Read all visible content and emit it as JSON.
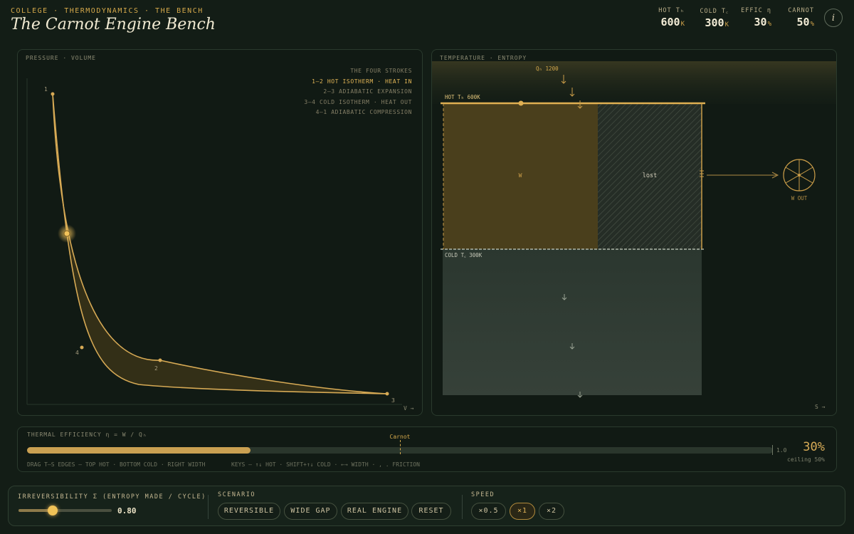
{
  "header": {
    "kicker": "COLLEGE · THERMODYNAMICS · THE BENCH",
    "title": "The Carnot Engine Bench",
    "stats": [
      {
        "label": "HOT Tₕ",
        "value": "600",
        "unit": "K"
      },
      {
        "label": "COLD T꜀",
        "value": "300",
        "unit": "K"
      },
      {
        "label": "EFFIC η",
        "value": "30",
        "unit": "%"
      },
      {
        "label": "CARNOT",
        "value": "50",
        "unit": "%"
      }
    ],
    "info_glyph": "i"
  },
  "pv": {
    "label": "PRESSURE · VOLUME",
    "axis_x": "V →",
    "legend_title": "THE FOUR STROKES",
    "strokes": [
      "1–2  HOT ISOTHERM · HEAT IN",
      "2–3  ADIABATIC EXPANSION",
      "3–4  COLD ISOTHERM · HEAT OUT",
      "4–1  ADIABATIC COMPRESSION"
    ],
    "active_stroke": 0,
    "points": [
      "1",
      "2",
      "3",
      "4"
    ]
  },
  "ts": {
    "label": "TEMPERATURE · ENTROPY",
    "qh_label": "Qₕ 1200",
    "hot_label": "HOT  Tₕ 600K",
    "cold_label": "COLD  T꜀ 300K",
    "work_label": "W",
    "lost_label": "lost",
    "wout_label": "W OUT",
    "axis_x": "S →"
  },
  "efficiency": {
    "label": "THERMAL EFFICIENCY  η = W / Qₕ",
    "value": 0.3,
    "carnot": 0.5,
    "carnot_label": "Carnot",
    "max_label": "1.0",
    "big_value": "30%",
    "ceiling": "ceiling 50%",
    "hint_drag": "DRAG T–S EDGES — TOP HOT · BOTTOM COLD · RIGHT WIDTH",
    "hint_keys": "KEYS — ↑↓ HOT · SHIFT+↑↓ COLD · ←→ WIDTH · , . FRICTION"
  },
  "controls": {
    "irrev_label": "IRREVERSIBILITY Σ (ENTROPY MADE / CYCLE)",
    "irrev_value": "0.80",
    "irrev_fraction": 0.37,
    "scenario_label": "SCENARIO",
    "scenarios": [
      "REVERSIBLE",
      "WIDE GAP",
      "REAL ENGINE",
      "RESET"
    ],
    "speed_label": "SPEED",
    "speeds": [
      "×0.5",
      "×1",
      "×2"
    ],
    "speed_selected": 1
  },
  "colors": {
    "accent": "#e0b052",
    "hot_fill": "#4a3f1c",
    "background": "#131d16"
  }
}
